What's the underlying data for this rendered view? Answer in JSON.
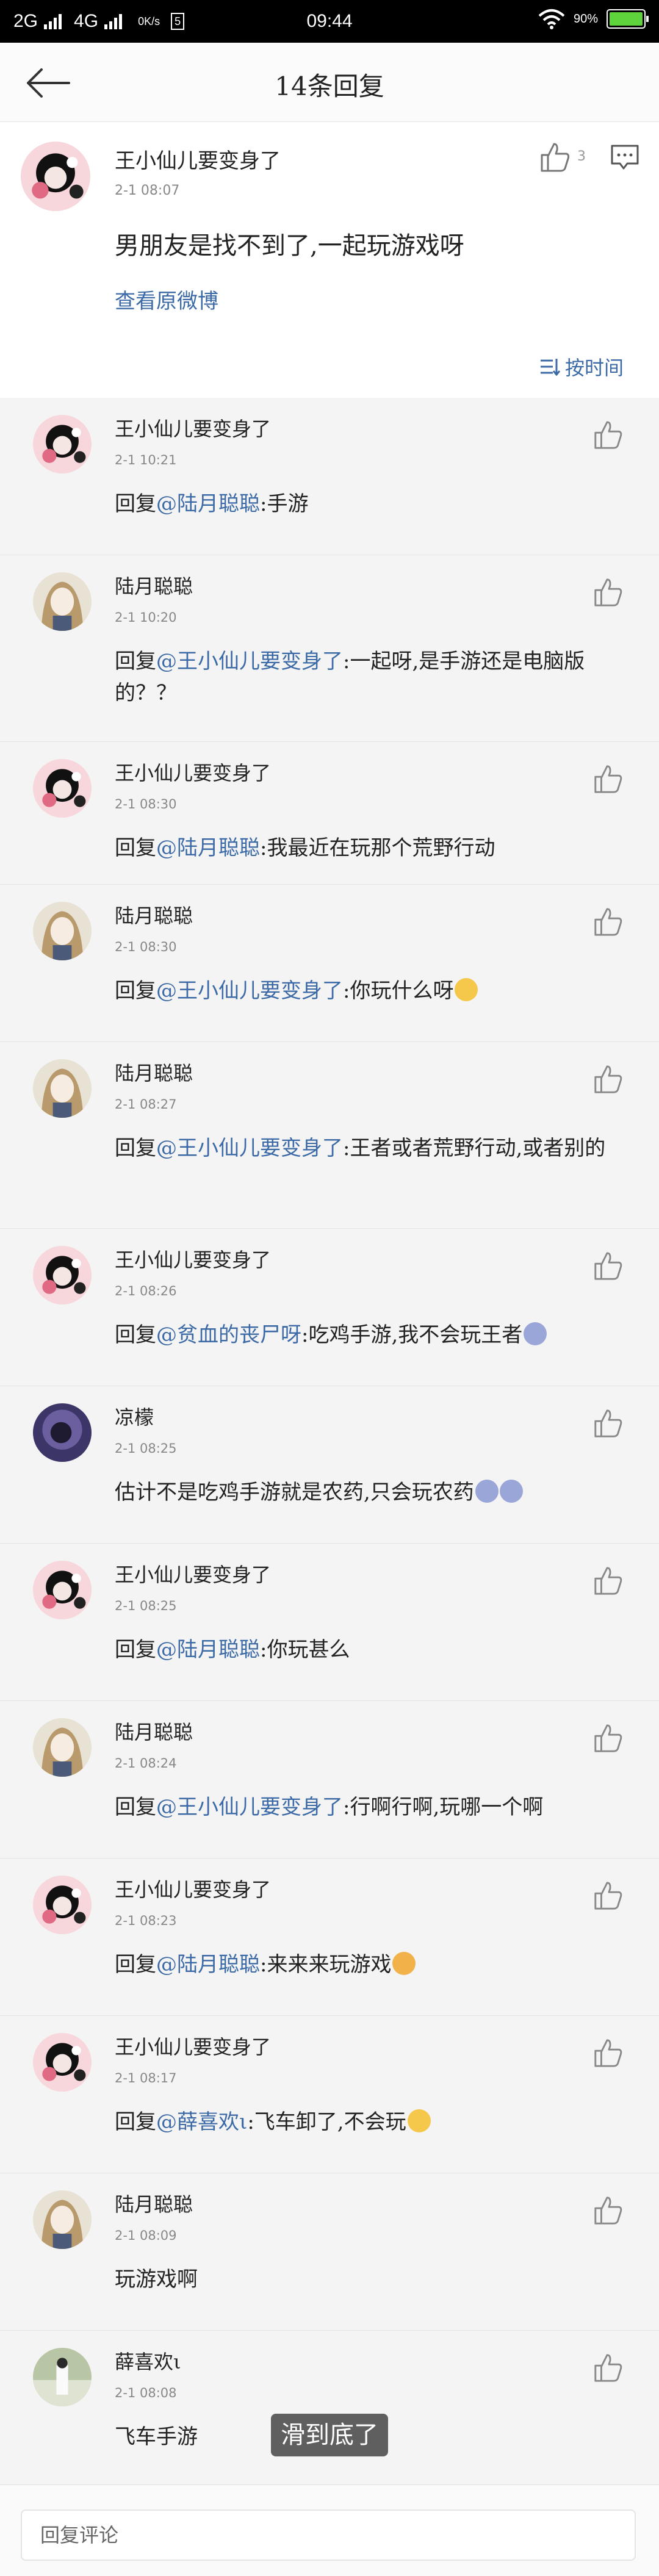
{
  "status_bar": {
    "network1": "2G",
    "network2": "4G",
    "speed": "0K/s",
    "badge": "5",
    "time": "09:44",
    "battery": "90%"
  },
  "header": {
    "title": "14条回复"
  },
  "post": {
    "author": "王小仙儿要变身了",
    "time": "2-1 08:07",
    "text": "男朋友是找不到了,一起玩游戏呀",
    "link": "查看原微博",
    "likes": "3",
    "sort_label": "按时间"
  },
  "replies": [
    {
      "name": "王小仙儿要变身了",
      "time": "2-1 10:21",
      "prefix": "回复",
      "mention": "@陆月聪聪",
      "text": ":手游",
      "avatar": "ponytail"
    },
    {
      "name": "陆月聪聪",
      "time": "2-1 10:20",
      "prefix": "回复",
      "mention": "@王小仙儿要变身了",
      "text": ":一起呀,是手游还是电脑版的？？",
      "avatar": "anime"
    },
    {
      "name": "王小仙儿要变身了",
      "time": "2-1 08:30",
      "prefix": "回复",
      "mention": "@陆月聪聪",
      "text": ":我最近在玩那个荒野行动",
      "avatar": "ponytail"
    },
    {
      "name": "陆月聪聪",
      "time": "2-1 08:30",
      "prefix": "回复",
      "mention": "@王小仙儿要变身了",
      "text": ":你玩什么呀",
      "emoji": "smirk-emoji",
      "avatar": "anime"
    },
    {
      "name": "陆月聪聪",
      "time": "2-1 08:27",
      "prefix": "回复",
      "mention": "@王小仙儿要变身了",
      "text": ":王者或者荒野行动,或者别的",
      "avatar": "anime"
    },
    {
      "name": "王小仙儿要变身了",
      "time": "2-1 08:26",
      "prefix": "回复",
      "mention": "@贫血的丧尸呀",
      "text": ":吃鸡手游,我不会玩王者",
      "emoji": "cry-emoji",
      "avatar": "ponytail"
    },
    {
      "name": "凉檬",
      "time": "2-1 08:25",
      "prefix": "",
      "mention": "",
      "text": "估计不是吃鸡手游就是农药,只会玩农药",
      "emoji": "cry-emoji",
      "emoji2": "cry-emoji",
      "avatar": "dark"
    },
    {
      "name": "王小仙儿要变身了",
      "time": "2-1 08:25",
      "prefix": "回复",
      "mention": "@陆月聪聪",
      "text": ":你玩甚么",
      "avatar": "ponytail"
    },
    {
      "name": "陆月聪聪",
      "time": "2-1 08:24",
      "prefix": "回复",
      "mention": "@王小仙儿要变身了",
      "text": ":行啊行啊,玩哪一个啊",
      "avatar": "anime"
    },
    {
      "name": "王小仙儿要变身了",
      "time": "2-1 08:23",
      "prefix": "回复",
      "mention": "@陆月聪聪",
      "text": ":来来来玩游戏",
      "emoji": "cat-emoji",
      "avatar": "ponytail"
    },
    {
      "name": "王小仙儿要变身了",
      "time": "2-1 08:17",
      "prefix": "回复",
      "mention": "@薛喜欢ι",
      "text": ":飞车卸了,不会玩",
      "emoji": "laugh-emoji",
      "avatar": "ponytail"
    },
    {
      "name": "陆月聪聪",
      "time": "2-1 08:09",
      "prefix": "",
      "mention": "",
      "text": "玩游戏啊",
      "avatar": "anime"
    },
    {
      "name": "薛喜欢ι",
      "time": "2-1 08:08",
      "prefix": "",
      "mention": "",
      "text": "飞车手游",
      "avatar": "photo"
    }
  ],
  "toast": "滑到底了",
  "input": {
    "placeholder": "回复评论"
  }
}
